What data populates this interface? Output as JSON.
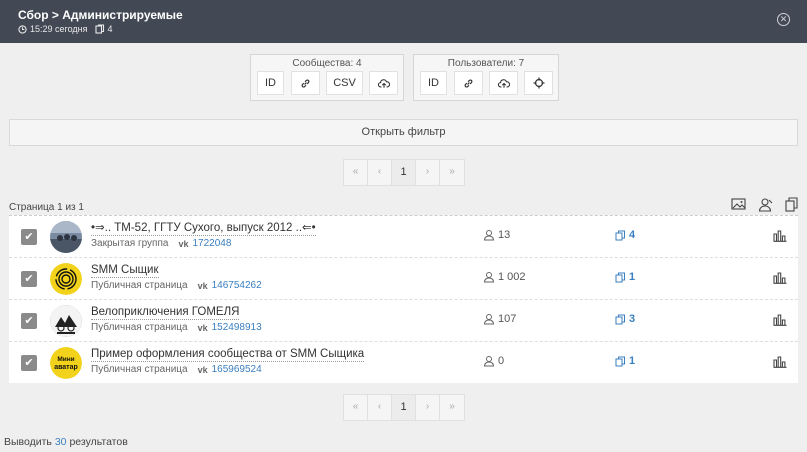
{
  "header": {
    "title": "Сбор > Администрируемые",
    "time": "15:29 сегодня",
    "count": "4"
  },
  "communities": {
    "label": "Сообщества: 4",
    "btn_id": "ID",
    "btn_csv": "CSV"
  },
  "users": {
    "label": "Пользователи: 7",
    "btn_id": "ID"
  },
  "filter": {
    "label": "Открыть фильтр"
  },
  "pager": {
    "first": "«",
    "prev": "‹",
    "current": "1",
    "next": "›",
    "last": "»"
  },
  "page_info": "Страница 1 из 1",
  "rows": [
    {
      "name": "•⇒.. ТМ-52, ГГТУ Сухого, выпуск 2012 ..⇐•",
      "type": "Закрытая группа",
      "vk": "vk",
      "id": "1722048",
      "members": "13",
      "posts": "4"
    },
    {
      "name": "SMM Сыщик",
      "type": "Публичная страница",
      "vk": "vk",
      "id": "146754262",
      "members": "1 002",
      "posts": "1"
    },
    {
      "name": "Велоприключения ГОМЕЛЯ",
      "type": "Публичная страница",
      "vk": "vk",
      "id": "152498913",
      "members": "107",
      "posts": "3"
    },
    {
      "name": "Пример оформления сообщества от SMM Сыщика",
      "type": "Публичная страница",
      "vk": "vk",
      "id": "165969524",
      "members": "0",
      "posts": "1"
    }
  ],
  "avatar4_text": [
    "Мини",
    "аватар"
  ],
  "footer": {
    "prefix": "Выводить",
    "count": "30",
    "suffix": "результатов"
  },
  "colors": {
    "header_bg": "#424955",
    "link": "#3a7fc0",
    "checkbox": "#8a8a8a"
  }
}
